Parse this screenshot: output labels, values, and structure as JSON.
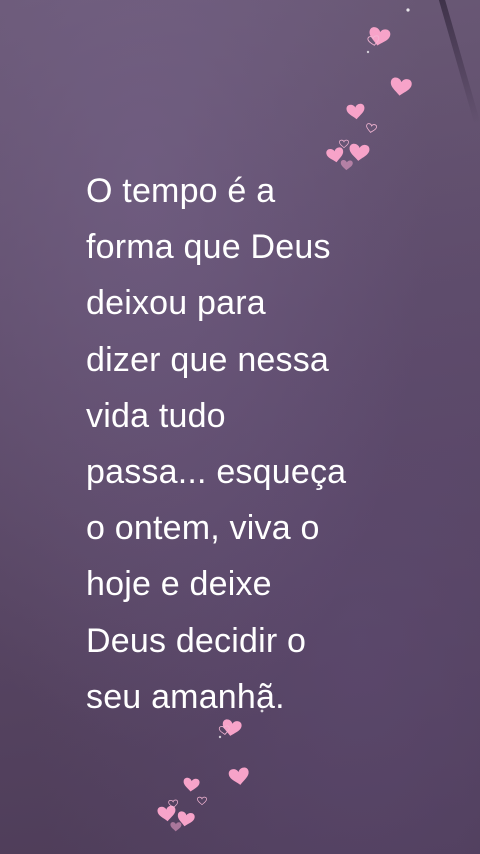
{
  "quote": {
    "lines": [
      "O tempo é a",
      "forma que Deus",
      "deixou para",
      "dizer que nessa",
      "vida tudo",
      "passa... esqueça",
      "o ontem, viva o",
      "hoje e deixe",
      "Deus decidir o",
      "seu amanhã."
    ]
  },
  "colors": {
    "text": "#ffffff",
    "heart_fill": "#f7a3c9",
    "heart_outline": "#f4b6d4"
  },
  "decorations": {
    "heart_icon": "heart-icon",
    "heart_outline_icon": "heart-outline-icon",
    "sparkle_icon": "sparkle-icon"
  }
}
